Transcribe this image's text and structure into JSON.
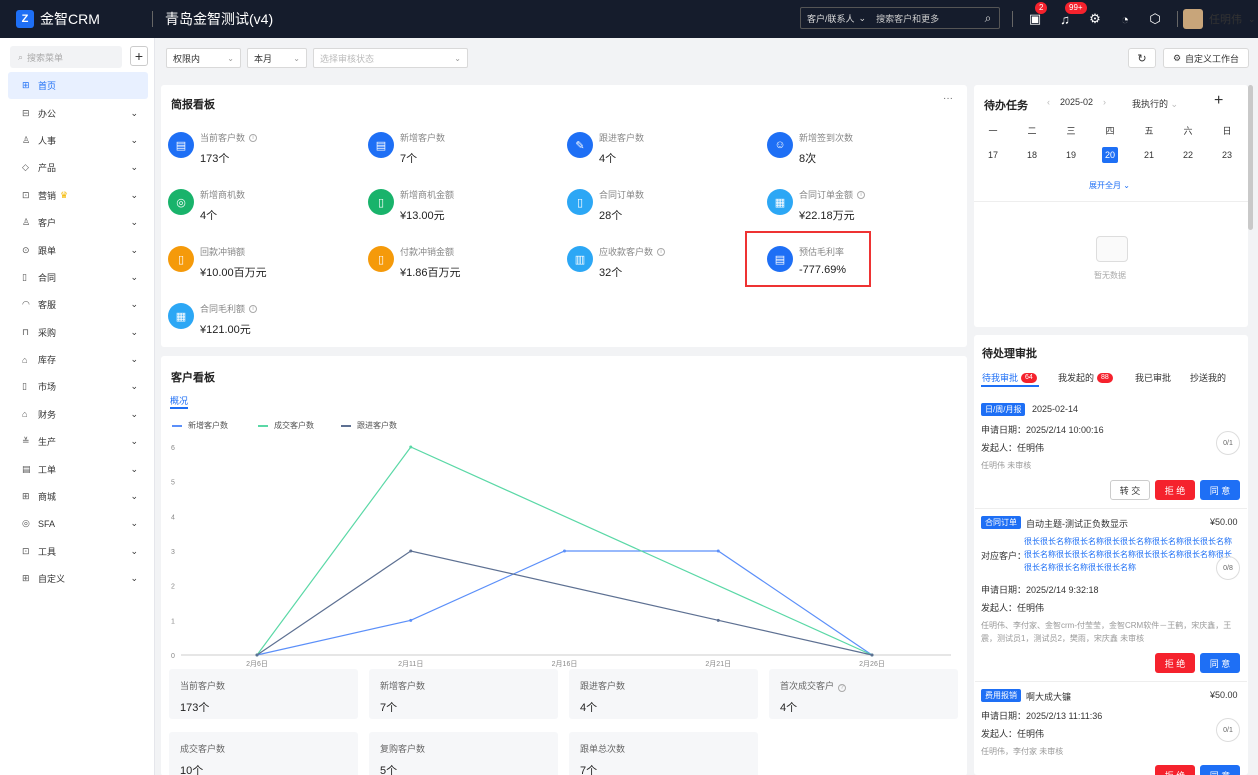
{
  "topbar": {
    "logo_mark": "Z",
    "logo_text": "金智CRM",
    "app_title": "青岛金智测试(v4)",
    "search_type": "客户/联系人",
    "search_placeholder": "搜索客户和更多",
    "badge_tasks": "2",
    "badge_notices": "99+",
    "user_name": "任明伟"
  },
  "sidebar": {
    "search_placeholder": "搜索菜单",
    "items": [
      {
        "label": "首页",
        "icon": "home-icon",
        "glyph": "⊞",
        "active": true,
        "has_children": false
      },
      {
        "label": "办公",
        "icon": "office-icon",
        "glyph": "⊟",
        "has_children": true
      },
      {
        "label": "人事",
        "icon": "person-icon",
        "glyph": "♙",
        "has_children": true
      },
      {
        "label": "产品",
        "icon": "product-icon",
        "glyph": "◇",
        "has_children": true
      },
      {
        "label": "营销",
        "icon": "marketing-icon",
        "glyph": "⊡",
        "has_children": true,
        "crown": true
      },
      {
        "label": "客户",
        "icon": "customer-icon",
        "glyph": "♙",
        "has_children": true
      },
      {
        "label": "跟单",
        "icon": "follow-icon",
        "glyph": "⊙",
        "has_children": true
      },
      {
        "label": "合同",
        "icon": "contract-icon",
        "glyph": "▯",
        "has_children": true
      },
      {
        "label": "客服",
        "icon": "service-icon",
        "glyph": "◠",
        "has_children": true
      },
      {
        "label": "采购",
        "icon": "purchase-icon",
        "glyph": "⊓",
        "has_children": true
      },
      {
        "label": "库存",
        "icon": "inventory-icon",
        "glyph": "⌂",
        "has_children": true
      },
      {
        "label": "市场",
        "icon": "market-icon",
        "glyph": "▯",
        "has_children": true
      },
      {
        "label": "财务",
        "icon": "finance-icon",
        "glyph": "⌂",
        "has_children": true
      },
      {
        "label": "生产",
        "icon": "production-icon",
        "glyph": "≚",
        "has_children": true
      },
      {
        "label": "工单",
        "icon": "workorder-icon",
        "glyph": "▤",
        "has_children": true
      },
      {
        "label": "商城",
        "icon": "mall-icon",
        "glyph": "⊞",
        "has_children": true
      },
      {
        "label": "SFA",
        "icon": "sfa-icon",
        "glyph": "◎",
        "has_children": true
      },
      {
        "label": "工具",
        "icon": "tool-icon",
        "glyph": "⊡",
        "has_children": true
      },
      {
        "label": "自定义",
        "icon": "custom-icon",
        "glyph": "⊞",
        "has_children": true
      }
    ]
  },
  "filters": {
    "scope": "权限内",
    "period": "本月",
    "status_placeholder": "选择审核状态",
    "custom_workbench": "自定义工作台"
  },
  "briefing": {
    "title": "简报看板",
    "more": "···",
    "kpis": [
      {
        "label": "当前客户数",
        "value": "173个",
        "color": "#1e6ff5",
        "icon": "building-icon",
        "info": true
      },
      {
        "label": "新增客户数",
        "value": "7个",
        "color": "#1e6ff5",
        "icon": "building-icon",
        "info": false
      },
      {
        "label": "跟进客户数",
        "value": "4个",
        "color": "#1e6ff5",
        "icon": "pen-icon",
        "info": false
      },
      {
        "label": "新增签到次数",
        "value": "8次",
        "color": "#1e6ff5",
        "icon": "checkin-icon",
        "info": false
      },
      {
        "label": "新增商机数",
        "value": "4个",
        "color": "#19b36b",
        "icon": "target-icon",
        "info": false
      },
      {
        "label": "新增商机金额",
        "value": "¥13.00元",
        "color": "#19b36b",
        "icon": "doc-money-icon",
        "info": false
      },
      {
        "label": "合同订单数",
        "value": "28个",
        "color": "#2ca7f5",
        "icon": "doc-icon",
        "info": false
      },
      {
        "label": "合同订单金额",
        "value": "¥22.18万元",
        "color": "#2ca7f5",
        "icon": "sheet-icon",
        "info": true
      },
      {
        "label": "回款冲销额",
        "value": "¥10.00百万元",
        "color": "#f59a0a",
        "icon": "doc-money-icon",
        "info": false
      },
      {
        "label": "付款冲销金额",
        "value": "¥1.86百万元",
        "color": "#f59a0a",
        "icon": "doc-money-icon",
        "info": false
      },
      {
        "label": "应收款客户数",
        "value": "32个",
        "color": "#2ca7f5",
        "icon": "clipboard-icon",
        "info": true
      },
      {
        "label": "预估毛利率",
        "value": "-777.69%",
        "color": "#1e6ff5",
        "icon": "building-icon",
        "info": false
      },
      {
        "label": "合同毛利额",
        "value": "¥121.00元",
        "color": "#2ca7f5",
        "icon": "sheet-icon",
        "info": true
      }
    ]
  },
  "customer_board": {
    "title": "客户看板",
    "tab": "概况",
    "stats": [
      {
        "label": "当前客户数",
        "value": "173个",
        "info": false
      },
      {
        "label": "新增客户数",
        "value": "7个",
        "info": false
      },
      {
        "label": "跟进客户数",
        "value": "4个",
        "info": false
      },
      {
        "label": "首次成交客户",
        "value": "4个",
        "info": true
      },
      {
        "label": "成交客户数",
        "value": "10个",
        "info": false
      },
      {
        "label": "复购客户数",
        "value": "5个",
        "info": false
      },
      {
        "label": "跟单总次数",
        "value": "7个",
        "info": false
      }
    ]
  },
  "chart_data": {
    "type": "line",
    "categories": [
      "2月6日",
      "2月11日",
      "2月16日",
      "2月21日",
      "2月26日"
    ],
    "y_ticks": [
      "0",
      "1",
      "2",
      "3",
      "4",
      "5",
      "6"
    ],
    "ylim": [
      0,
      6
    ],
    "grid": false,
    "legend_position": "top-left",
    "series": [
      {
        "name": "新增客户数",
        "color": "#5b8ff9",
        "x": [
          0,
          5,
          10,
          15,
          20
        ],
        "values": [
          0,
          1,
          3,
          3,
          0
        ]
      },
      {
        "name": "成交客户数",
        "color": "#5ad8a6",
        "x": [
          0,
          5,
          20
        ],
        "values": [
          0,
          6,
          0
        ]
      },
      {
        "name": "跟进客户数",
        "color": "#5d7092",
        "x": [
          0,
          5,
          15,
          20
        ],
        "values": [
          0,
          3,
          1,
          0
        ]
      }
    ]
  },
  "todo": {
    "title": "待办任务",
    "month": "2025-02",
    "filter": "我执行的",
    "weekdays": [
      "一",
      "二",
      "三",
      "四",
      "五",
      "六",
      "日"
    ],
    "days": [
      "17",
      "18",
      "19",
      "20",
      "21",
      "22",
      "23"
    ],
    "today_index": 3,
    "expand": "展开全月",
    "empty": "暂无数据"
  },
  "approvals": {
    "title": "待处理审批",
    "tabs": [
      {
        "label": "待我审批",
        "badge": "64"
      },
      {
        "label": "我发起的",
        "badge": "88"
      },
      {
        "label": "我已审批",
        "badge": ""
      },
      {
        "label": "抄送我的",
        "badge": ""
      }
    ],
    "items": [
      {
        "tag": "日/周/月报",
        "title": "2025-02-14",
        "apply_date": "申请日期：2025/2/14 10:00:16",
        "initiator": "发起人：任明伟",
        "approvers": "任明伟 未审核",
        "progress": "0/1",
        "buttons": [
          "转 交",
          "拒 绝",
          "同 意"
        ]
      },
      {
        "tag": "合同订单",
        "title": "自动主题-测试正负数显示",
        "amount": "¥50.00",
        "customer_label": "对应客户：",
        "customer": "很长很长名称很长名称很长很长名称很长名称很长很长名称很长名称很长很长名称很长名称很长很长名称很长名称很长很长名称很长名称很长很长名称",
        "apply_date": "申请日期：2025/2/14 9:32:18",
        "initiator": "发起人：任明伟",
        "approvers": "任明伟、李付家、金智crm-付莹莹，金智CRM软件－王鹤，宋庆鑫，王震，测试员1，测试员2，樊雨，宋庆鑫 未审核",
        "progress": "0/8",
        "buttons": [
          "拒 绝",
          "同 意"
        ]
      },
      {
        "tag": "费用报销",
        "title": "啊大成大镰",
        "amount": "¥50.00",
        "apply_date": "申请日期：2025/2/13 11:11:36",
        "initiator": "发起人：任明伟",
        "approvers": "任明伟，李付家 未审核",
        "progress": "0/1",
        "buttons": [
          "拒 绝",
          "同 意"
        ]
      }
    ]
  }
}
